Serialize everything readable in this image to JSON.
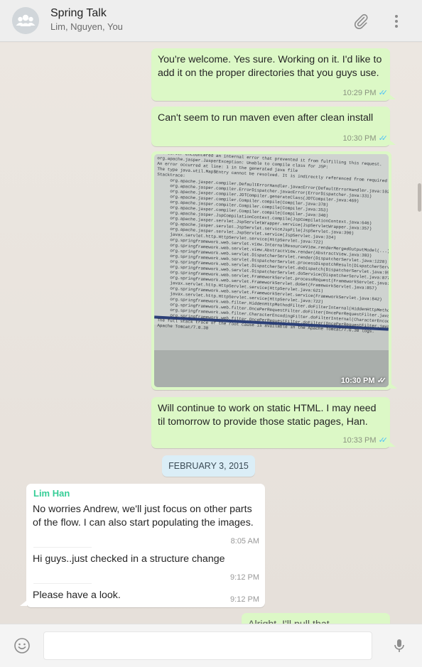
{
  "header": {
    "title": "Spring Talk",
    "participants": "Lim, Nguyen, You",
    "icons": [
      "group-avatar-icon",
      "paperclip-icon",
      "kebab-menu-icon"
    ]
  },
  "messages": [
    {
      "dir": "out",
      "text_lines": [
        "You're welcome. Yes sure. Working on it. I'd like to",
        "add it on the proper directories that you guys use."
      ],
      "time": "10:29 PM",
      "status": "read"
    },
    {
      "dir": "out",
      "text_lines": [
        "Can't seem to run maven even after clean install"
      ],
      "time": "10:30 PM",
      "status": "read"
    },
    {
      "dir": "out",
      "type": "image",
      "time": "10:30 PM",
      "status": "read",
      "image": {
        "description_lines": [
          "The server encountered an internal error that prevented it from fulfilling this request.",
          "org.apache.jasper.JasperException: Unable to compile class for JSP:",
          "An error occurred at line: 1 in the generated java file",
          "The type java.util.Map$Entry cannot be resolved. It is indirectly referenced from required .class files",
          "Stacktrace:",
          "org.apache.jasper.compiler.DefaultErrorHandler.javacError(DefaultErrorHandler.java:102)",
          "org.apache.jasper.compiler.ErrorDispatcher.javacError(ErrorDispatcher.java:331)",
          "org.apache.jasper.compiler.JDTCompiler.generateClass(JDTCompiler.java:469)",
          "org.apache.jasper.compiler.Compiler.compile(Compiler.java:378)",
          "org.apache.jasper.compiler.Compiler.compile(Compiler.java:353)",
          "org.apache.jasper.compiler.Compiler.compile(Compiler.java:340)",
          "org.apache.jasper.JspCompilationContext.compile(JspCompilationContext.java:646)",
          "org.apache.jasper.servlet.JspServletWrapper.service(JspServletWrapper.java:357)",
          "org.apache.jasper.servlet.JspServlet.serviceJspFile(JspServlet.java:390)",
          "org.apache.jasper.servlet.JspServlet.service(JspServlet.java:334)",
          "javax.servlet.http.HttpServlet.service(HttpServlet.java:722)",
          "org.springframework.web.servlet.view.InternalResourceView.renderMergedOutputModel(...)",
          "org.springframework.web.servlet.view.AbstractView.render(AbstractView.java:303)",
          "org.springframework.web.servlet.DispatcherServlet.render(DispatcherServlet.java:1228)",
          "org.springframework.web.servlet.DispatcherServlet.processDispatchResult(DispatcherServlet.java:1011)",
          "org.springframework.web.servlet.DispatcherServlet.doDispatch(DispatcherServlet.java:955)",
          "org.springframework.web.servlet.DispatcherServlet.doService(DispatcherServlet.java:877)",
          "org.springframework.web.servlet.FrameworkServlet.processRequest(FrameworkServlet.java:966)",
          "org.springframework.web.servlet.FrameworkServlet.doGet(FrameworkServlet.java:857)",
          "javax.servlet.http.HttpServlet.service(HttpServlet.java:621)",
          "org.springframework.web.servlet.FrameworkServlet.service(FrameworkServlet.java:842)",
          "javax.servlet.http.HttpServlet.service(HttpServlet.java:722)",
          "org.springframework.web.filter.HiddenHttpMethodFilter.doFilterInternal(HiddenHttpMethodFilter.java:77)",
          "org.springframework.web.filter.OncePerRequestFilter.doFilter(OncePerRequestFilter.java:107)",
          "org.springframework.web.filter.CharacterEncodingFilter.doFilterInternal(CharacterEncodingFilter.java:88)",
          "org.springframework.web.filter.OncePerRequestFilter.doFilter(OncePerRequestFilter.java:107)",
          "The full stack trace of the root cause is available in the Apache Tomcat/7.0.30 logs.",
          "Apache Tomcat/7.0.30"
        ]
      }
    },
    {
      "dir": "out",
      "text_lines": [
        "Will continue to work on static HTML. I may need",
        "til tomorrow to provide those static pages, Han."
      ],
      "time": "10:33 PM",
      "status": "read"
    }
  ],
  "date_divider": "FEBRUARY 3, 2015",
  "incoming_group": {
    "sender": "Lim Han",
    "sender_color": "#35cd96",
    "items": [
      {
        "text_lines": [
          "No worries Andrew, we'll just focus on other parts",
          "of the flow. I can also start populating the images."
        ],
        "time": "8:05 AM"
      },
      {
        "text_lines": [
          "Hi guys..just checked in a structure change"
        ],
        "time": "9:12 PM"
      },
      {
        "text_lines": [
          "Please have a look."
        ],
        "time": "9:12 PM"
      }
    ]
  },
  "partial_message": {
    "text": "Alright. I'll pull that"
  },
  "composer": {
    "value": "",
    "placeholder": ""
  },
  "colors": {
    "outgoing": "#dcf8c6",
    "incoming": "#ffffff",
    "read_ticks": "#4fc3f7",
    "date_chip": "#dbeef7"
  }
}
